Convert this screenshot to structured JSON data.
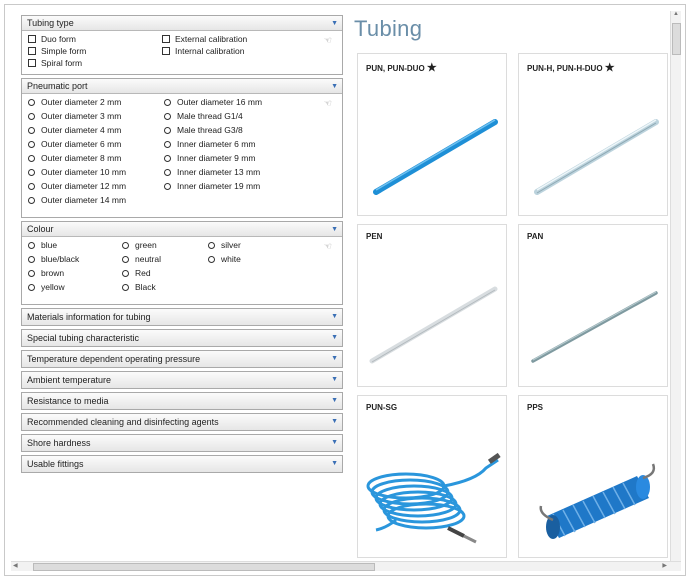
{
  "panels": {
    "tubing_type": {
      "title": "Tubing type",
      "options": [
        "Duo form",
        "External calibration",
        "Simple form",
        "Internal calibration",
        "Spiral form"
      ]
    },
    "pneumatic_port": {
      "title": "Pneumatic port",
      "options": [
        "Outer diameter 2 mm",
        "Outer diameter 16 mm",
        "Outer diameter 3 mm",
        "Male thread G1/4",
        "Outer diameter 4 mm",
        "Male thread G3/8",
        "Outer diameter 6 mm",
        "Inner diameter 6 mm",
        "Outer diameter 8 mm",
        "Inner diameter 9 mm",
        "Outer diameter 10 mm",
        "Inner diameter 13 mm",
        "Outer diameter 12 mm",
        "Inner diameter 19 mm",
        "Outer diameter 14 mm"
      ]
    },
    "colour": {
      "title": "Colour",
      "options": [
        "blue",
        "green",
        "silver",
        "blue/black",
        "neutral",
        "white",
        "brown",
        "Red",
        "yellow",
        "Black"
      ]
    },
    "collapsed": [
      "Materials information for tubing",
      "Special tubing characteristic",
      "Temperature dependent operating pressure",
      "Ambient temperature",
      "Resistance to media",
      "Recommended cleaning and disinfecting agents",
      "Shore hardness",
      "Usable fittings"
    ]
  },
  "products": {
    "heading": "Tubing",
    "items": [
      {
        "label": "PUN, PUN-DUO",
        "star": "★",
        "icon": "blue-tube-icon",
        "color": "#1e8fd6"
      },
      {
        "label": "PUN-H, PUN-H-DUO",
        "star": "★",
        "icon": "clear-tube-icon",
        "color": "#bcd3dd"
      },
      {
        "label": "PEN",
        "star": "",
        "icon": "white-tube-icon",
        "color": "#d8dde0"
      },
      {
        "label": "PAN",
        "star": "",
        "icon": "grey-tube-icon",
        "color": "#7f9aa0"
      },
      {
        "label": "PUN-SG",
        "star": "",
        "icon": "spiral-tube-icon",
        "color": "#2a96dc"
      },
      {
        "label": "PPS",
        "star": "",
        "icon": "spiral-blue-tube-icon",
        "color": "#1f78c8"
      }
    ]
  }
}
